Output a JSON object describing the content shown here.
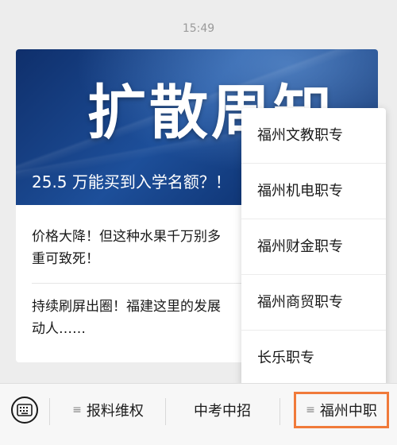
{
  "timestamp": "15:49",
  "article_card": {
    "cover_title": "扩散周知",
    "cover_headline": "25.5 万能买到入学名额？！",
    "articles": [
      {
        "line1": "价格大降！但这种水果千万别多",
        "line2": "重可致死！"
      },
      {
        "line1": "持续刷屏出圈！福建这里的发展",
        "line2": "动人……"
      }
    ]
  },
  "popup_menu": {
    "items": [
      {
        "label": "福州文教职专"
      },
      {
        "label": "福州机电职专"
      },
      {
        "label": "福州财金职专"
      },
      {
        "label": "福州商贸职专"
      },
      {
        "label": "长乐职专"
      }
    ]
  },
  "bottom_menu": {
    "keyboard_icon": "keyboard-icon",
    "items": [
      {
        "label": "报料维权",
        "has_submenu": true
      },
      {
        "label": "中考中招",
        "has_submenu": false
      },
      {
        "label": "福州中职",
        "has_submenu": true,
        "selected": true
      }
    ]
  },
  "colors": {
    "highlight": "#f07a3a",
    "background": "#ededed"
  }
}
